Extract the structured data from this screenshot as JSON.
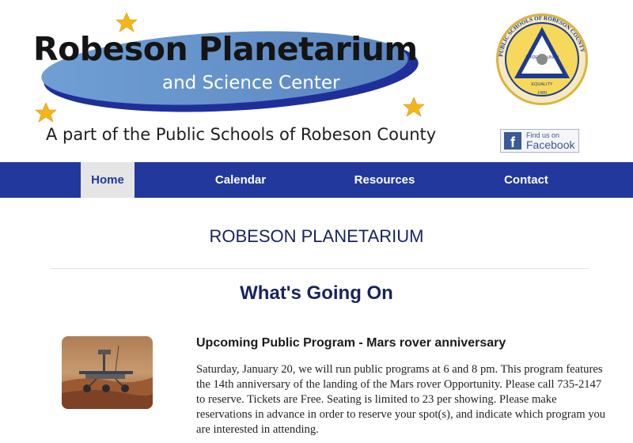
{
  "header": {
    "logo": {
      "title": "Robeson Planetarium",
      "subtitle": "and Science Center",
      "tagline": "A part of the Public Schools of Robeson County"
    },
    "seal": {
      "ring_text": "PUBLIC SCHOOLS OF ROBESON COUNTY",
      "words": [
        "PRIDE",
        "UNITY",
        "EQUALITY"
      ],
      "year": "1989"
    },
    "facebook": {
      "small": "Find us on",
      "big": "Facebook"
    }
  },
  "nav": {
    "items": [
      {
        "label": "Home",
        "active": true
      },
      {
        "label": "Calendar",
        "active": false
      },
      {
        "label": "Resources",
        "active": false
      },
      {
        "label": "Contact",
        "active": false
      }
    ]
  },
  "main": {
    "page_title": "ROBESON PLANETARIUM",
    "section_title": "What's Going On",
    "post": {
      "title": "Upcoming Public Program - Mars rover anniversary",
      "body": "Saturday, January 20, we will run public programs at 6 and 8 pm. This program features the 14th anniversary of the landing of the Mars rover Opportunity. Please call 735-2147 to reserve. Tickets are Free. Seating is limited to 23 per showing. Please make reservations in advance in order to reserve your spot(s), and indicate which program you are interested in attending."
    }
  },
  "colors": {
    "nav_bg": "#22389d",
    "heading": "#17245e",
    "logo_ellipse": "#6d9acf",
    "facebook": "#3b5998"
  }
}
